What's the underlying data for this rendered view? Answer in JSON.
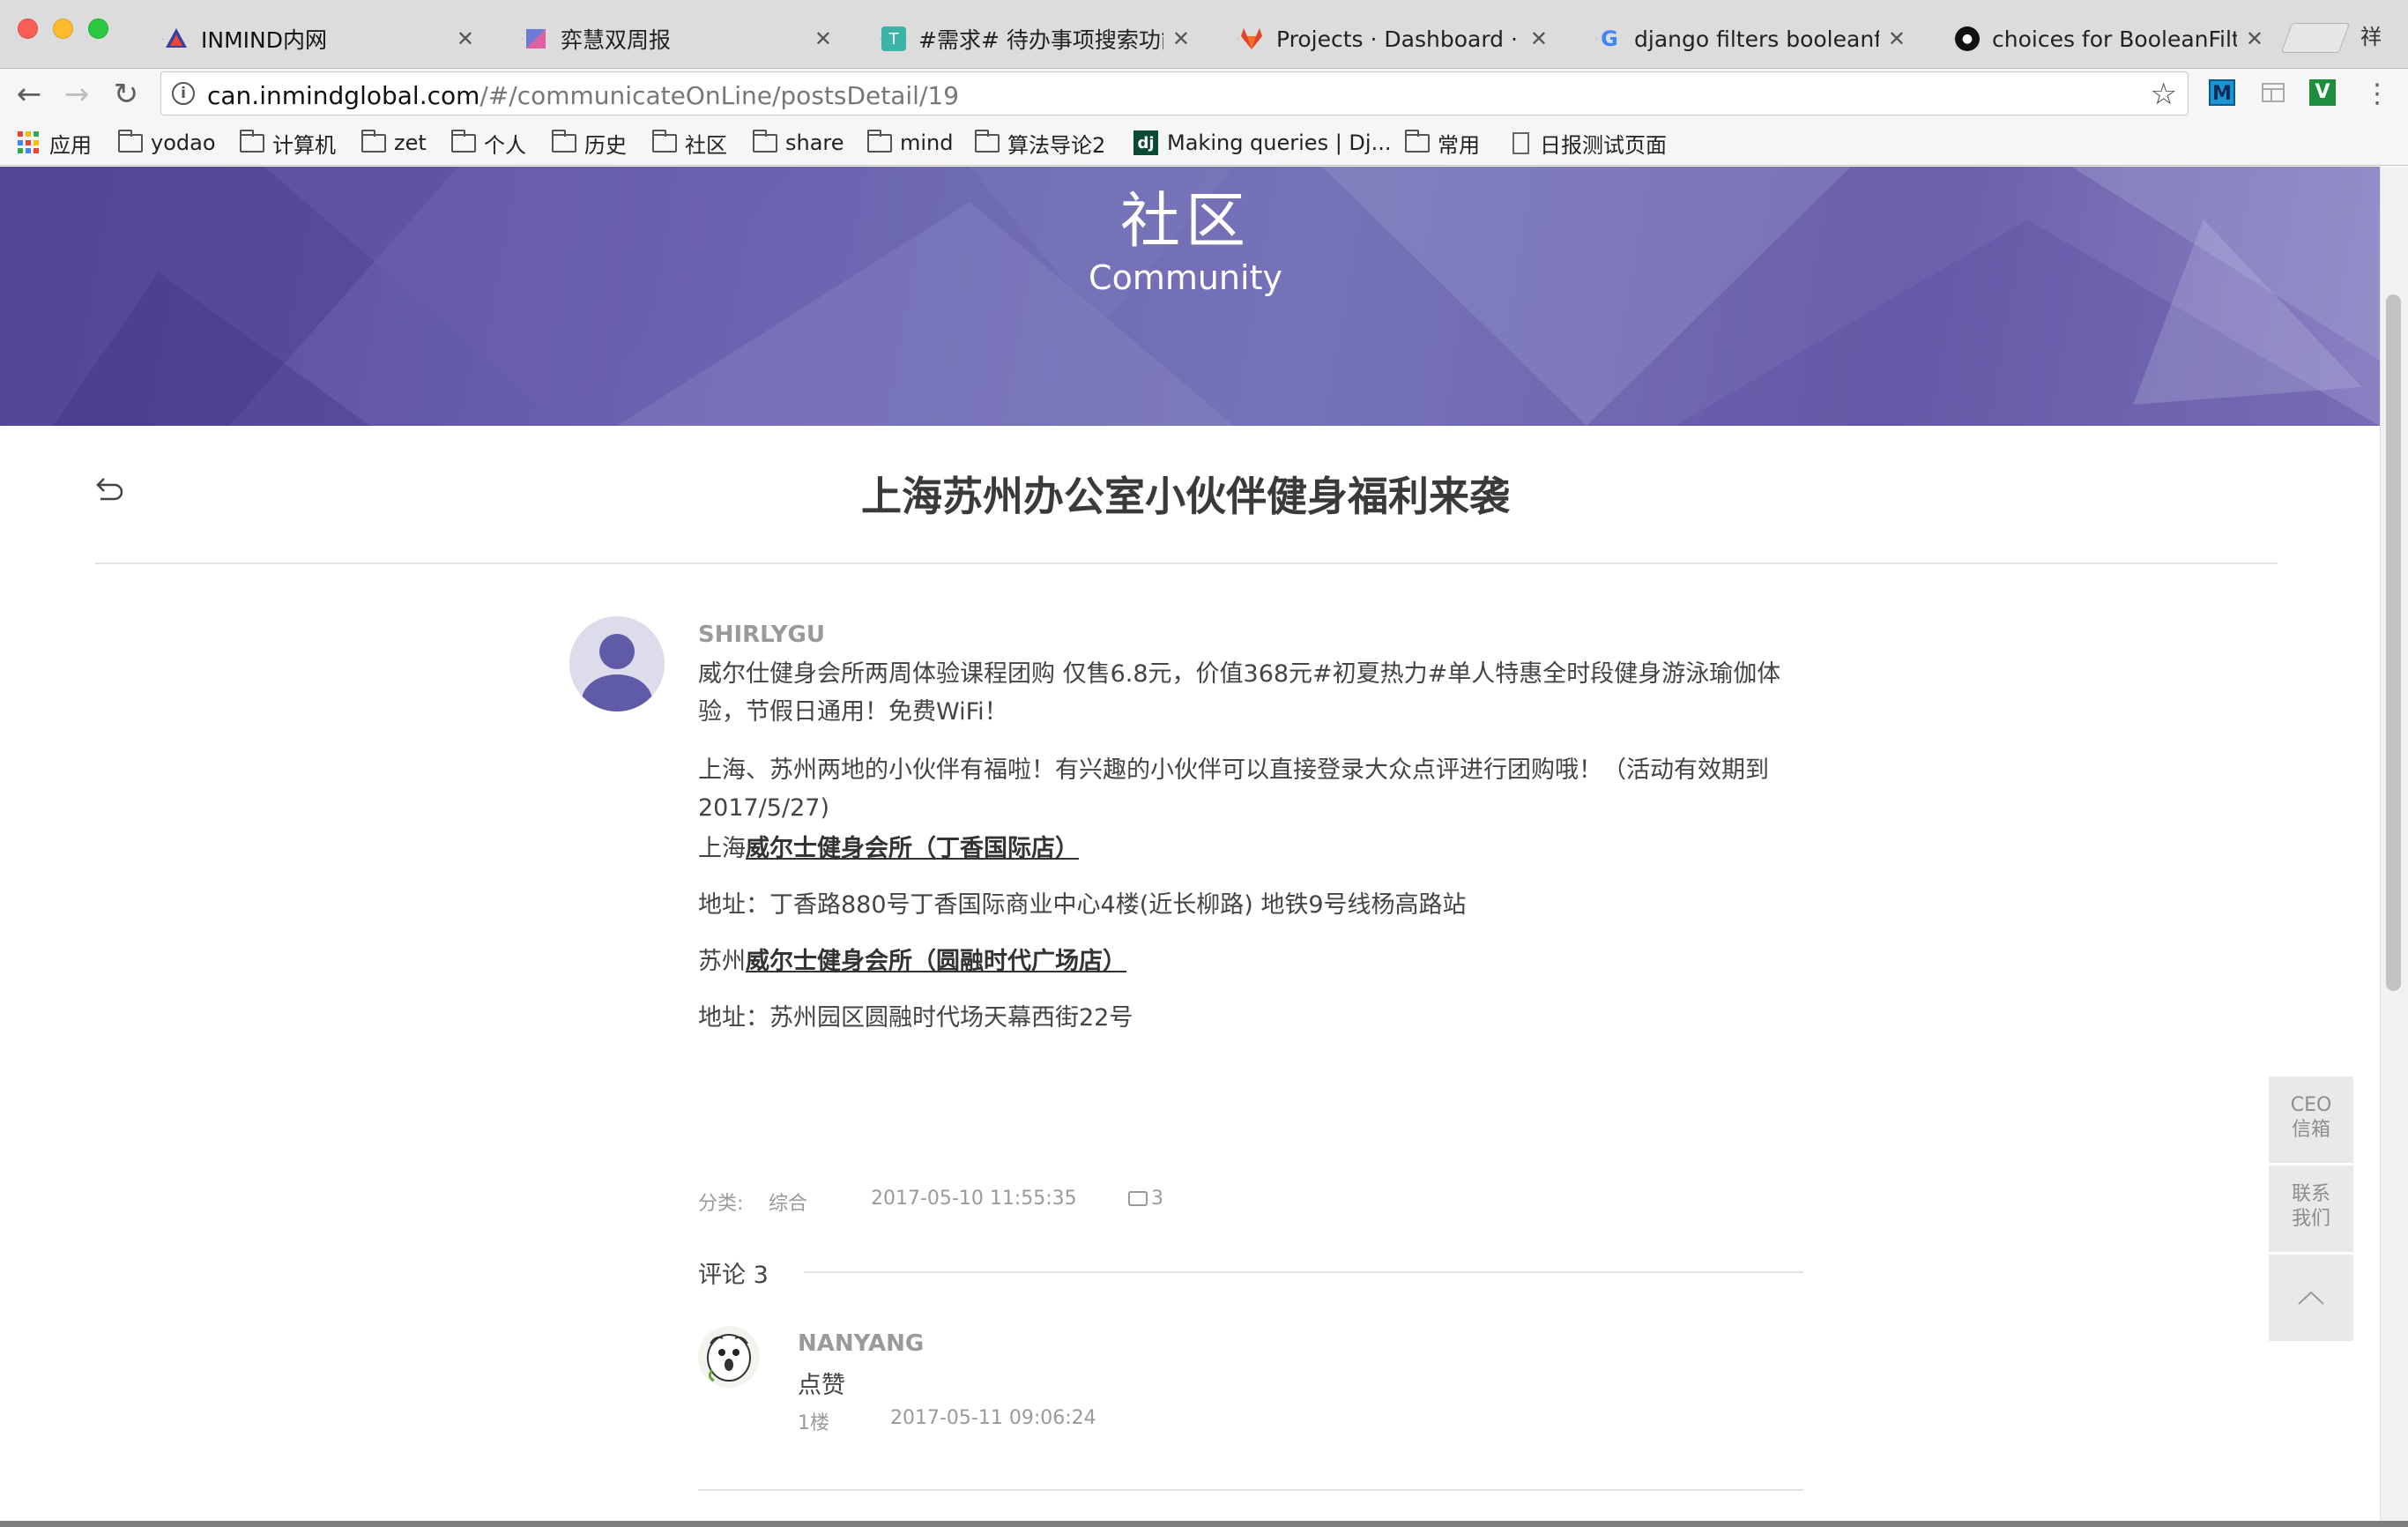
{
  "browser": {
    "tabs": [
      {
        "title": "INMIND内网",
        "active": true
      },
      {
        "title": "弈慧双周报",
        "active": false
      },
      {
        "title": "#需求# 待办事项搜索功能",
        "active": false
      },
      {
        "title": "Projects · Dashboard · Git",
        "active": false
      },
      {
        "title": "django filters booleanfield",
        "active": false
      },
      {
        "title": "choices for BooleanFilter",
        "active": false
      }
    ],
    "profile_label": "祥",
    "address": {
      "host": "can.inmindglobal.com",
      "path": "/#/communicateOnLine/postsDetail/19"
    },
    "bookmarks": [
      "应用",
      "yodao",
      "计算机",
      "zet",
      "个人",
      "历史",
      "社区",
      "share",
      "mind",
      "算法导论2",
      "Making queries | Dj...",
      "常用",
      "日报测试页面"
    ],
    "extensions": [
      "M",
      "V"
    ]
  },
  "hero": {
    "title": "社区",
    "subtitle": "Community"
  },
  "post": {
    "title": "上海苏州办公室小伙伴健身福利来袭",
    "author": "SHIRLYGU",
    "para1": "威尔仕健身会所两周体验课程团购 仅售6.8元，价值368元#初夏热力#单人特惠全时段健身游泳瑜伽体验，节假日通用！免费WiFi！",
    "para2": "上海、苏州两地的小伙伴有福啦！有兴趣的小伙伴可以直接登录大众点评进行团购哦！（活动有效期到2017/5/27)",
    "shanghai_prefix": "上海",
    "shanghai_link": "威尔士健身会所（丁香国际店）",
    "shanghai_address": "地址：丁香路880号丁香国际商业中心4楼(近长柳路) 地铁9号线杨高路站",
    "suzhou_prefix": "苏州",
    "suzhou_link": "威尔士健身会所（圆融时代广场店）",
    "suzhou_address": "地址：苏州园区圆融时代场天幕西街22号",
    "category_label": "分类:",
    "category": "综合",
    "datetime": "2017-05-10 11:55:35",
    "comment_count": "3"
  },
  "comments": {
    "header": "评论 3",
    "items": [
      {
        "name": "NANYANG",
        "text": "点赞",
        "floor": "1楼",
        "time": "2017-05-11 09:06:24"
      }
    ]
  },
  "floating": {
    "ceo_line1": "CEO",
    "ceo_line2": "信箱",
    "contact_line1": "联系",
    "contact_line2": "我们"
  },
  "colors": {
    "hero_primary": "#6a63b0",
    "accent": "#5f5ba6"
  }
}
